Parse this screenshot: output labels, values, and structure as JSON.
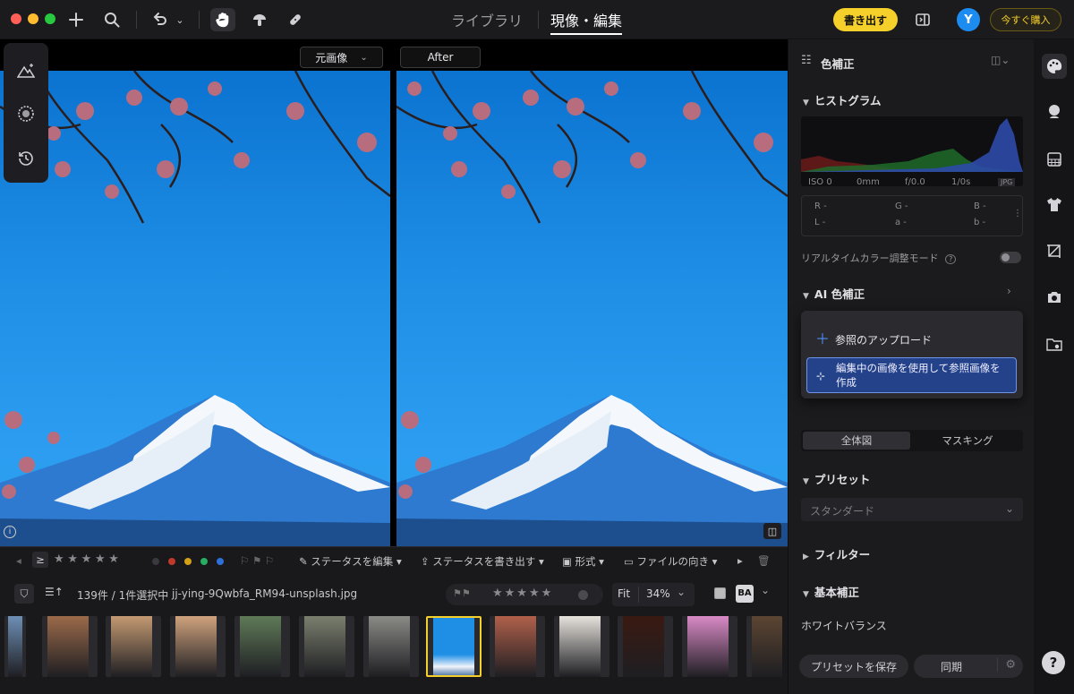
{
  "topbar": {
    "nav_tabs": [
      {
        "label": "ライブラリ",
        "active": false
      },
      {
        "label": "現像・編集",
        "active": true
      }
    ],
    "export_label": "書き出す",
    "avatar_initial": "Y",
    "buy_label": "今すぐ購入",
    "icons": [
      "add-icon",
      "search-icon",
      "undo-icon",
      "chevron-down-icon",
      "hand-icon",
      "mushroom-icon",
      "bandage-icon",
      "panel-toggle-icon"
    ]
  },
  "viewer": {
    "before_label": "元画像",
    "after_label": "After"
  },
  "right_panel": {
    "header_title": "色補正",
    "histogram_title": "ヒストグラム",
    "exif": {
      "iso": "ISO 0",
      "focal": "0mm",
      "aperture": "f/0.0",
      "shutter": "1/0s",
      "format": "JPG"
    },
    "readout": {
      "r": "R -",
      "g": "G -",
      "b": "B -",
      "l": "L -",
      "a": "a -",
      "b2": "b -"
    },
    "realtime_label": "リアルタイムカラー調整モード",
    "ai_title": "AI 色補正",
    "popup": {
      "upload_label": "参照のアップロード",
      "create_label": "編集中の画像を使用して参照画像を作成"
    },
    "seg_tabs": [
      "全体図",
      "マスキング"
    ],
    "preset_title": "プリセット",
    "preset_value": "スタンダード",
    "filter_title": "フィルター",
    "basic_title": "基本補正",
    "wb_label": "ホワイトバランス",
    "save_preset_label": "プリセットを保存",
    "sync_label": "同期",
    "help_label": "?"
  },
  "meta_bar": {
    "ge_label": "≥",
    "stars": [
      "★",
      "★",
      "★",
      "★",
      "★"
    ],
    "color_labels": [
      "#3a3a3e",
      "#c0392b",
      "#d4a017",
      "#27ae60",
      "#2e6fd8"
    ],
    "edit_status_label": "ステータスを編集",
    "export_status_label": "ステータスを書き出す",
    "format_label": "形式",
    "orientation_label": "ファイルの向き"
  },
  "file_bar": {
    "count_label": "139件 / 1件選択中",
    "filename": "jj-ying-9Qwbfa_RM94-unsplash.jpg",
    "fit_label": "Fit",
    "zoom_value": "34%",
    "ba_label": "BA"
  },
  "filmstrip": {
    "thumbs": [
      {
        "color": "#6e8fb5",
        "selected": false
      },
      {
        "color": "#9b6a4a",
        "selected": false
      },
      {
        "color": "#c49a72",
        "selected": false
      },
      {
        "color": "#cfa27d",
        "selected": false
      },
      {
        "color": "#5f7a58",
        "selected": false
      },
      {
        "color": "#7b7f6e",
        "selected": false
      },
      {
        "color": "#8a8a86",
        "selected": false
      },
      {
        "color": "#1f8fe6",
        "selected": true
      },
      {
        "color": "#b0604a",
        "selected": false
      },
      {
        "color": "#e6e2dc",
        "selected": false
      },
      {
        "color": "#3a1a12",
        "selected": false
      },
      {
        "color": "#d98ac6",
        "selected": false
      },
      {
        "color": "#5c4532",
        "selected": false
      }
    ]
  }
}
